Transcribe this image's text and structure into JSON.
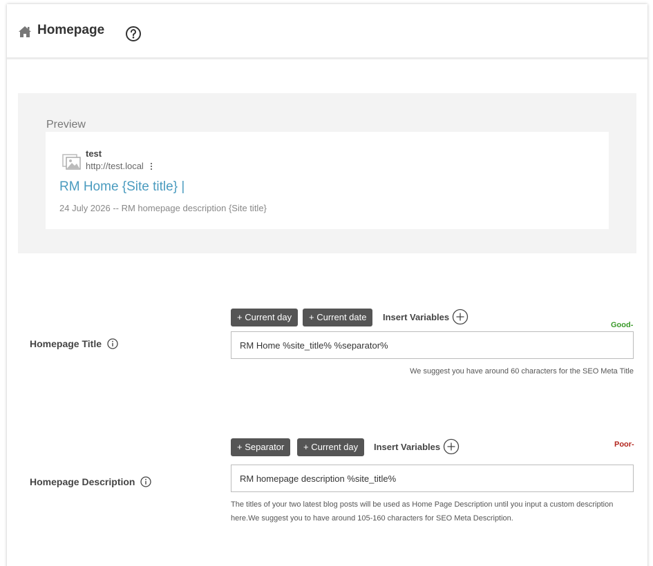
{
  "header": {
    "title": "Homepage",
    "icon": "home-icon",
    "help_icon": "help-circle-icon"
  },
  "preview": {
    "label": "Preview",
    "site_name": "test",
    "site_url": "http://test.local",
    "title": "RM Home {Site title} |",
    "description": "24 July 2026 -- RM homepage description {Site title}",
    "title_color": "#4a9bbf"
  },
  "homepage_title": {
    "label": "Homepage Title",
    "chips": [
      "+ Current day",
      "+ Current date"
    ],
    "insert_label": "Insert Variables",
    "status": "Good-",
    "status_color": "#3a9a2a",
    "value": "RM Home %site_title% %separator%",
    "hint": "We suggest you have around 60 characters for the SEO Meta Title"
  },
  "homepage_description": {
    "label": "Homepage Description",
    "chips": [
      "+ Separator",
      "+ Current day"
    ],
    "insert_label": "Insert Variables",
    "status": "Poor-",
    "status_color": "#b3261e",
    "value": "RM homepage description %site_title%",
    "hint_line1": "The titles of your two latest blog posts will be used as Home Page Description until you input a custom description",
    "hint_line2": "here.We suggest you to have around 105-160 characters for SEO Meta Description."
  },
  "colors": {
    "chip_bg": "#555555",
    "preview_bg": "#f3f3f3"
  }
}
